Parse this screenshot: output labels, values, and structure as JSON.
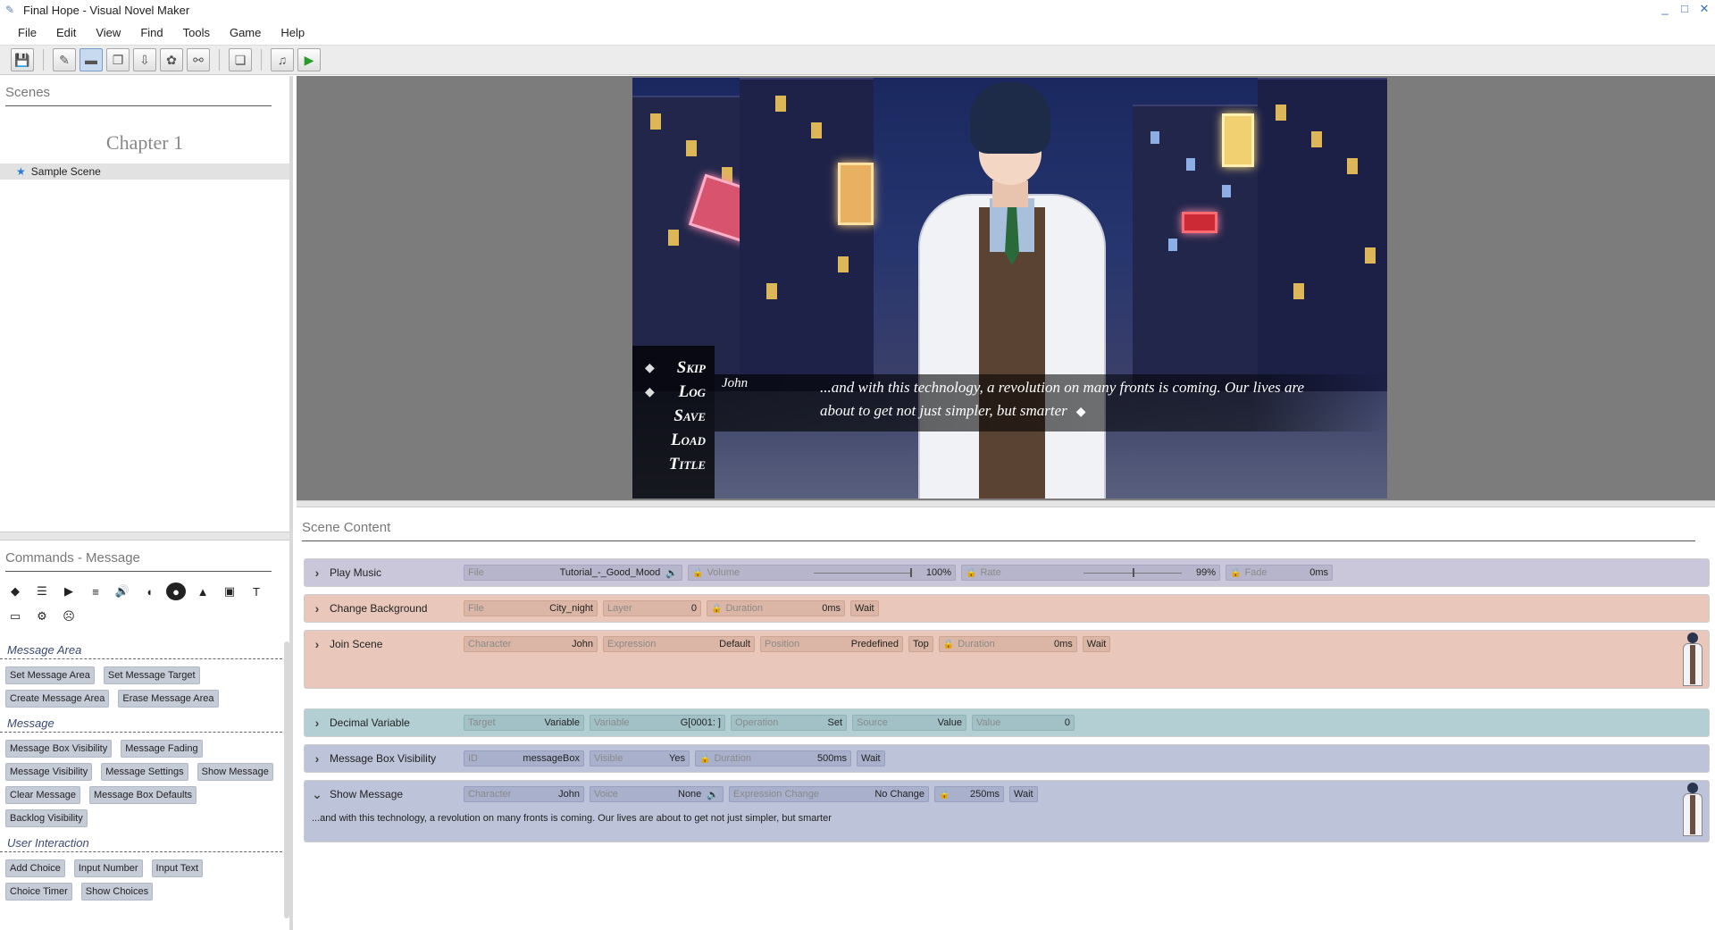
{
  "window": {
    "title": "Final Hope - Visual Novel Maker",
    "min": "_",
    "max": "□",
    "close": "✕"
  },
  "menu": [
    "File",
    "Edit",
    "View",
    "Find",
    "Tools",
    "Game",
    "Help"
  ],
  "toolbar_icons": [
    "save-icon",
    "edit-icon",
    "scene-icon",
    "copy-icon",
    "import-icon",
    "assets-icon",
    "link-icon",
    "windows-icon",
    "music-icon",
    "play-icon"
  ],
  "scenes": {
    "title": "Scenes",
    "chapter": "Chapter 1",
    "items": [
      "Sample Scene"
    ]
  },
  "commands": {
    "title": "Commands - Message",
    "categories": [
      {
        "name": "Message Area",
        "buttons": [
          "Set Message Area",
          "Set Message Target",
          "Create Message Area",
          "Erase Message Area"
        ]
      },
      {
        "name": "Message",
        "buttons": [
          "Message Box Visibility",
          "Message Fading",
          "Message Visibility",
          "Message Settings",
          "Show Message",
          "Clear Message",
          "Message Box Defaults",
          "Backlog Visibility"
        ]
      },
      {
        "name": "User Interaction",
        "buttons": [
          "Add Choice",
          "Input Number",
          "Input Text",
          "Choice Timer",
          "Show Choices"
        ]
      }
    ]
  },
  "game": {
    "menu": [
      "Skip",
      "Log",
      "Save",
      "Load",
      "Title"
    ],
    "speaker": "John",
    "message": "...and with this technology, a revolution on many fronts is coming. Our lives are about to get not just simpler, but smarter",
    "arrow": "◆"
  },
  "scene_content": {
    "title": "Scene Content",
    "play_music": {
      "name": "Play Music",
      "file_label": "File",
      "file": "Tutorial_-_Good_Mood",
      "volume_label": "Volume",
      "volume": "100%",
      "volume_value": 1.0,
      "rate_label": "Rate",
      "rate": "99%",
      "rate_value": 0.99,
      "fade_label": "Fade",
      "fade": "0ms"
    },
    "change_background": {
      "name": "Change Background",
      "file_label": "File",
      "file": "City_night",
      "layer_label": "Layer",
      "layer": "0",
      "duration_label": "Duration",
      "duration": "0ms",
      "wait": "Wait"
    },
    "join_scene": {
      "name": "Join Scene",
      "character_label": "Character",
      "character": "John",
      "expression_label": "Expression",
      "expression": "Default",
      "position_label": "Position",
      "position": "Predefined",
      "position2": "Top",
      "duration_label": "Duration",
      "duration": "0ms",
      "wait": "Wait"
    },
    "decimal_variable": {
      "name": "Decimal Variable",
      "target_label": "Target",
      "target": "Variable",
      "variable_label": "Variable",
      "variable": "G[0001: ]",
      "operation_label": "Operation",
      "operation": "Set",
      "source_label": "Source",
      "source": "Value",
      "value_label": "Value",
      "value": "0"
    },
    "message_box_visibility": {
      "name": "Message Box Visibility",
      "id_label": "ID",
      "id": "messageBox",
      "visible_label": "Visible",
      "visible": "Yes",
      "duration_label": "Duration",
      "duration": "500ms",
      "wait": "Wait"
    },
    "show_message": {
      "name": "Show Message",
      "character_label": "Character",
      "character": "John",
      "voice_label": "Voice",
      "voice": "None",
      "expression_label": "Expression Change",
      "expression": "No Change",
      "duration": "250ms",
      "wait": "Wait",
      "text": "...and with this technology, a revolution on many fronts is coming. Our lives are about to get not just simpler, but smarter"
    }
  }
}
